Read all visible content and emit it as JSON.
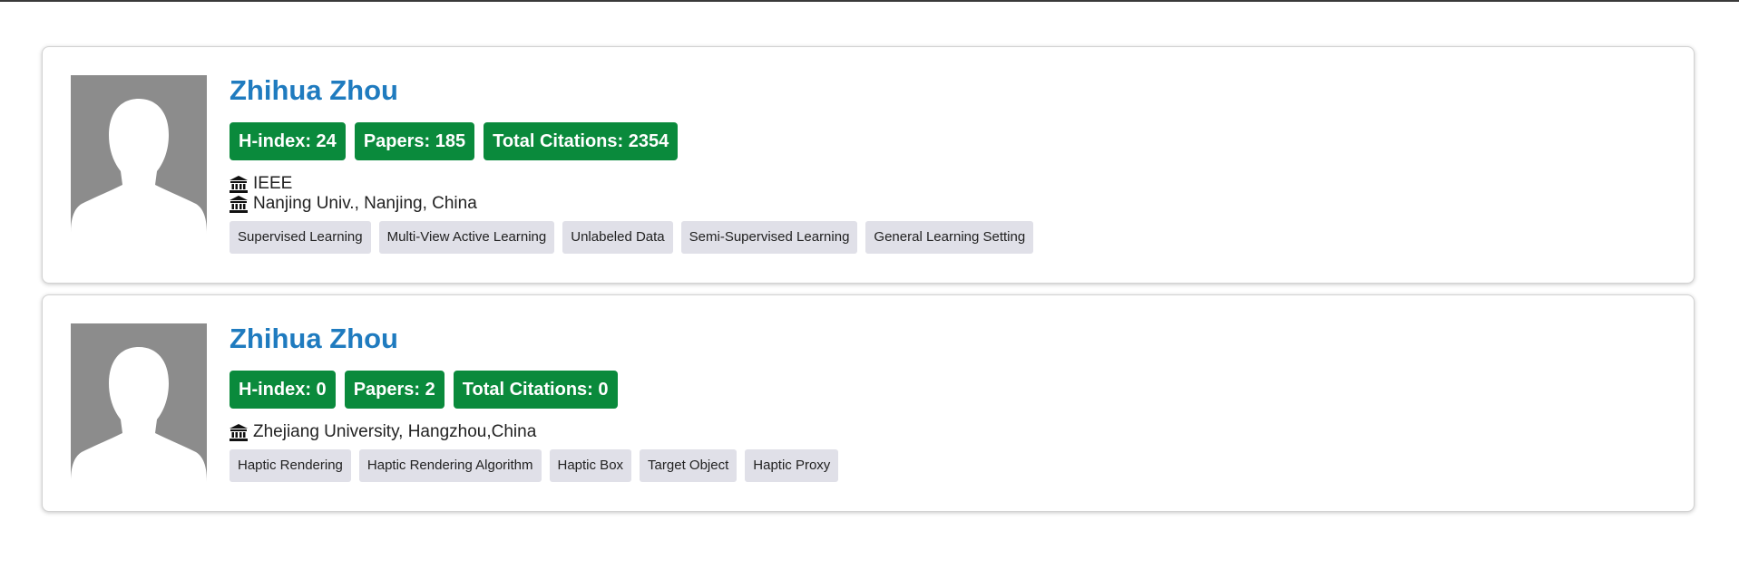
{
  "results": [
    {
      "name": "Zhihua Zhou",
      "stats": {
        "hindex": "H-index: 24",
        "papers": "Papers: 185",
        "citations": "Total Citations: 2354"
      },
      "affiliations": [
        "IEEE",
        "Nanjing Univ., Nanjing, China"
      ],
      "tags": [
        "Supervised Learning",
        "Multi-View Active Learning",
        "Unlabeled Data",
        "Semi-Supervised Learning",
        "General Learning Setting"
      ]
    },
    {
      "name": "Zhihua Zhou",
      "stats": {
        "hindex": "H-index: 0",
        "papers": "Papers: 2",
        "citations": "Total Citations: 0"
      },
      "affiliations": [
        "Zhejiang University, Hangzhou,China"
      ],
      "tags": [
        "Haptic Rendering",
        "Haptic Rendering Algorithm",
        "Haptic Box",
        "Target Object",
        "Haptic Proxy"
      ]
    }
  ],
  "colors": {
    "name": "#1f7bbf",
    "stat_badge": "#0a8a3c",
    "tag_bg": "#e0e0e8",
    "avatar_bg": "#8c8c8c"
  },
  "icons": {
    "avatar": "default-person-silhouette",
    "affiliation": "institution-building-icon"
  }
}
